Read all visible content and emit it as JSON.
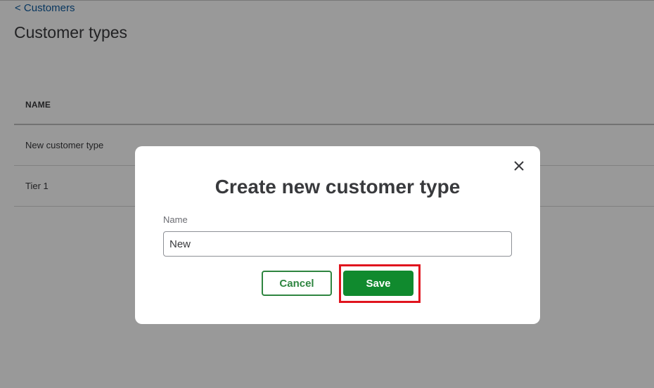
{
  "breadcrumb": {
    "label": "< Customers"
  },
  "page": {
    "title": "Customer types"
  },
  "table": {
    "header": "NAME",
    "rows": [
      {
        "name": "New customer type"
      },
      {
        "name": "Tier 1"
      }
    ]
  },
  "modal": {
    "title": "Create new customer type",
    "name_label": "Name",
    "name_value": "New",
    "cancel_label": "Cancel",
    "save_label": "Save",
    "close_icon": "close-icon"
  },
  "colors": {
    "brand_green": "#108a2e",
    "link_blue": "#0d5a9e",
    "highlight_red": "#e0141e"
  }
}
